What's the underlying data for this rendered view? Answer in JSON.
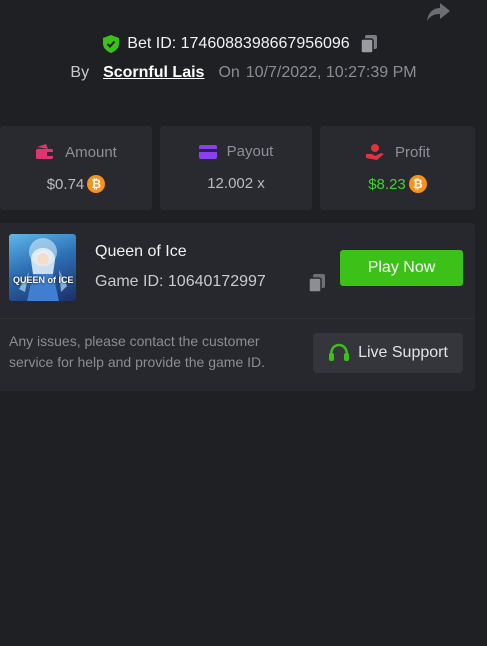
{
  "header": {
    "bet_id_label": "Bet ID: 1746088398667956096",
    "by_label": "By",
    "author": "Scornful Lais",
    "on_label": "On",
    "datetime": "10/7/2022, 10:27:39 PM"
  },
  "stats": {
    "amount": {
      "label": "Amount",
      "value": "$0.74",
      "currency_icon": "bitcoin-icon"
    },
    "payout": {
      "label": "Payout",
      "value": "12.002 x"
    },
    "profit": {
      "label": "Profit",
      "value": "$8.23",
      "currency_icon": "bitcoin-icon",
      "color": "#3ed32c"
    }
  },
  "game": {
    "name": "Queen of Ice",
    "id_label": "Game ID: 10640172997",
    "thumb_text": "QUEEN of ICE",
    "play_label": "Play Now"
  },
  "support": {
    "message": "Any issues, please contact the customer service for help and provide the game ID.",
    "button_label": "Live Support"
  },
  "colors": {
    "accent_green": "#3bc117",
    "bitcoin": "#f7931a",
    "amount_icon": "#e0336f",
    "payout_icon": "#8a3ff0",
    "profit_icon": "#e0333b"
  }
}
